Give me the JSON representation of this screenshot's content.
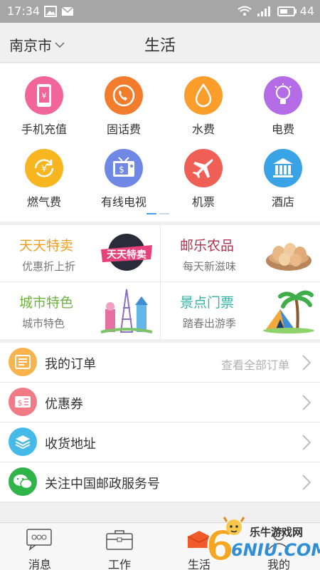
{
  "status_bar": {
    "time": "17:34",
    "battery": "44"
  },
  "header": {
    "city": "南京市",
    "title": "生活"
  },
  "services": [
    {
      "label": "手机充值",
      "icon": "phone-icon",
      "color": "#f2659b"
    },
    {
      "label": "固话费",
      "icon": "telephone-icon",
      "color": "#f27c2c"
    },
    {
      "label": "水费",
      "icon": "water-drop-icon",
      "color": "#fa9d2a"
    },
    {
      "label": "电费",
      "icon": "lightbulb-icon",
      "color": "#b36be6"
    },
    {
      "label": "燃气费",
      "icon": "gas-icon",
      "color": "#f7b620"
    },
    {
      "label": "有线电视",
      "icon": "tv-icon",
      "color": "#6f88e6"
    },
    {
      "label": "机票",
      "icon": "airplane-icon",
      "color": "#f05f55"
    },
    {
      "label": "酒店",
      "icon": "hotel-icon",
      "color": "#3aa3e6"
    }
  ],
  "promos": [
    {
      "title": "天天特卖",
      "subtitle": "优惠折上折",
      "color": "#f39c1f",
      "image_text": "天天特卖"
    },
    {
      "title": "邮乐农品",
      "subtitle": "每天新滋味",
      "color": "#b0334f"
    },
    {
      "title": "城市特色",
      "subtitle": "城市特色",
      "color": "#6cb33f"
    },
    {
      "title": "景点门票",
      "subtitle": "踏春出游季",
      "color": "#2eb5a7"
    }
  ],
  "menu": [
    {
      "label": "我的订单",
      "hint": "查看全部订单",
      "icon": "order-icon",
      "color": "#f7b34d"
    },
    {
      "label": "优惠券",
      "hint": "",
      "icon": "coupon-icon",
      "color": "#f07a86"
    },
    {
      "label": "收货地址",
      "hint": "",
      "icon": "address-icon",
      "color": "#45b9e8"
    },
    {
      "label": "关注中国邮政服务号",
      "hint": "",
      "icon": "wechat-icon",
      "color": "#2fb44a"
    }
  ],
  "tabs": [
    {
      "label": "消息",
      "icon": "message-icon"
    },
    {
      "label": "工作",
      "icon": "briefcase-icon"
    },
    {
      "label": "生活",
      "icon": "life-icon"
    },
    {
      "label": "我的",
      "icon": "profile-icon"
    }
  ],
  "watermark": {
    "text": "乐牛游戏网",
    "url": "6NIU.COM"
  }
}
